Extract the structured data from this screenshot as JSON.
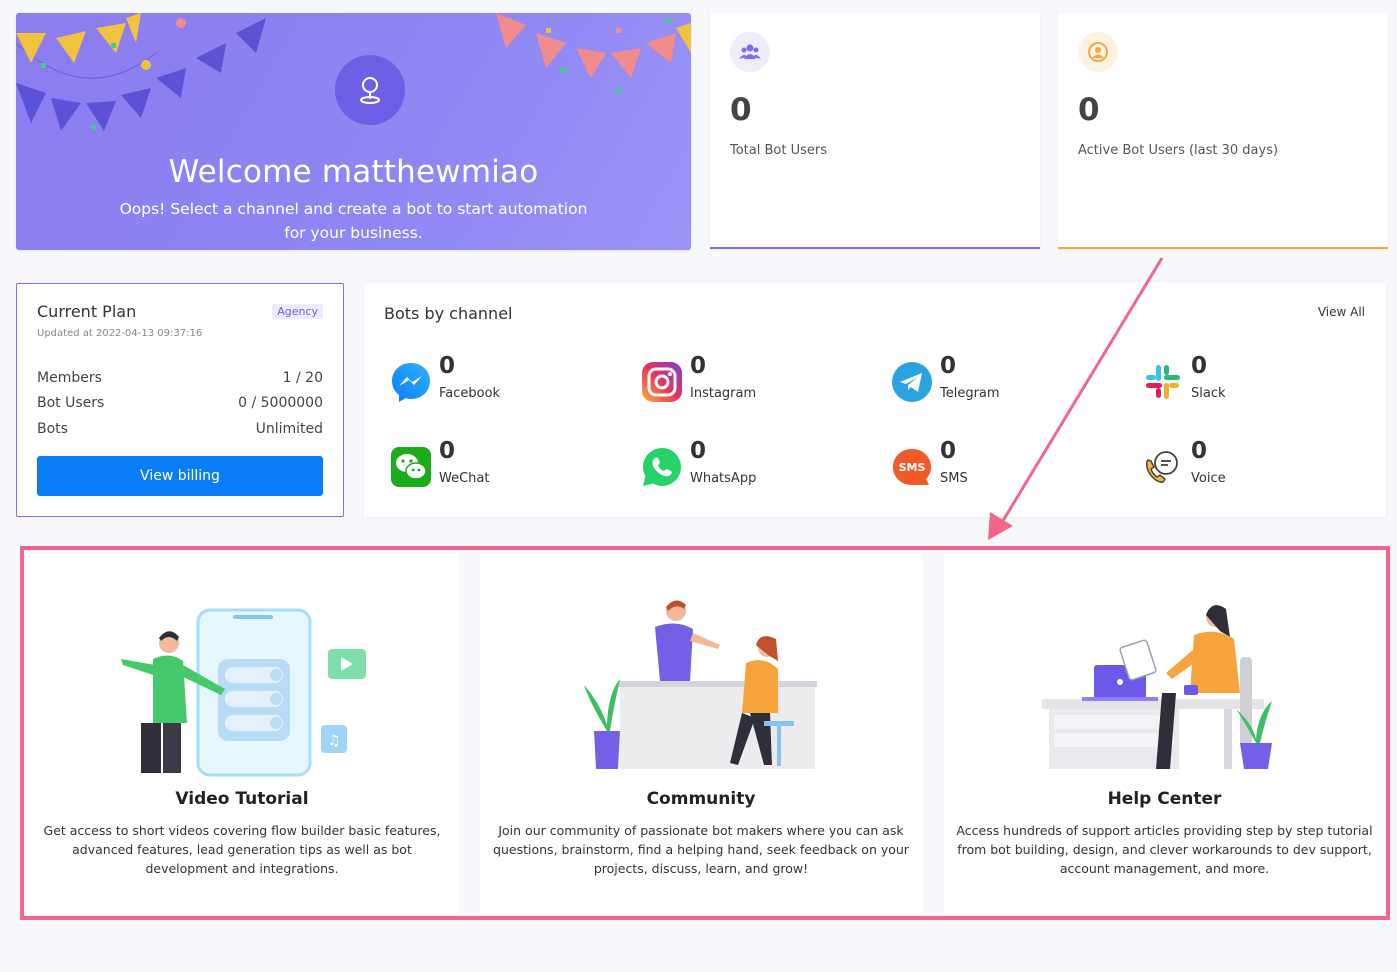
{
  "welcome": {
    "title": "Welcome matthewmiao",
    "subtitle": "Oops! Select a channel and create a bot to start automation for your business."
  },
  "stats": [
    {
      "value": "0",
      "label": "Total Bot Users",
      "icon": "users-icon",
      "accent": "#7b6ff0"
    },
    {
      "value": "0",
      "label": "Active Bot Users (last 30 days)",
      "icon": "active-user-icon",
      "accent": "#f3a942"
    }
  ],
  "plan": {
    "title": "Current Plan",
    "badge": "Agency",
    "updated": "Updated at 2022-04-13 09:37:16",
    "rows": [
      {
        "label": "Members",
        "value": "1 / 20"
      },
      {
        "label": "Bot Users",
        "value": "0 / 5000000"
      },
      {
        "label": "Bots",
        "value": "Unlimited"
      }
    ],
    "button": "View billing"
  },
  "channels": {
    "title": "Bots by channel",
    "view_all": "View All",
    "items": [
      {
        "count": "0",
        "name": "Facebook",
        "icon": "messenger-icon"
      },
      {
        "count": "0",
        "name": "Instagram",
        "icon": "instagram-icon"
      },
      {
        "count": "0",
        "name": "Telegram",
        "icon": "telegram-icon"
      },
      {
        "count": "0",
        "name": "Slack",
        "icon": "slack-icon"
      },
      {
        "count": "0",
        "name": "WeChat",
        "icon": "wechat-icon"
      },
      {
        "count": "0",
        "name": "WhatsApp",
        "icon": "whatsapp-icon"
      },
      {
        "count": "0",
        "name": "SMS",
        "icon": "sms-icon"
      },
      {
        "count": "0",
        "name": "Voice",
        "icon": "voice-icon"
      }
    ]
  },
  "resources": [
    {
      "title": "Video Tutorial",
      "description": "Get access to short videos covering flow builder basic features, advanced features, lead generation tips as well as bot development and integrations."
    },
    {
      "title": "Community",
      "description": "Join our community of passionate bot makers where you can ask questions, brainstorm, find a helping hand, seek feedback on your projects, discuss, learn, and grow!"
    },
    {
      "title": "Help Center",
      "description": "Access hundreds of support articles providing step by step tutorial from bot building, design, and clever workarounds to dev support, account management, and more."
    }
  ],
  "colors": {
    "primary": "#0a7ef6",
    "purple": "#7b6ff0",
    "orange": "#f3a942",
    "highlight": "#f2668b"
  }
}
